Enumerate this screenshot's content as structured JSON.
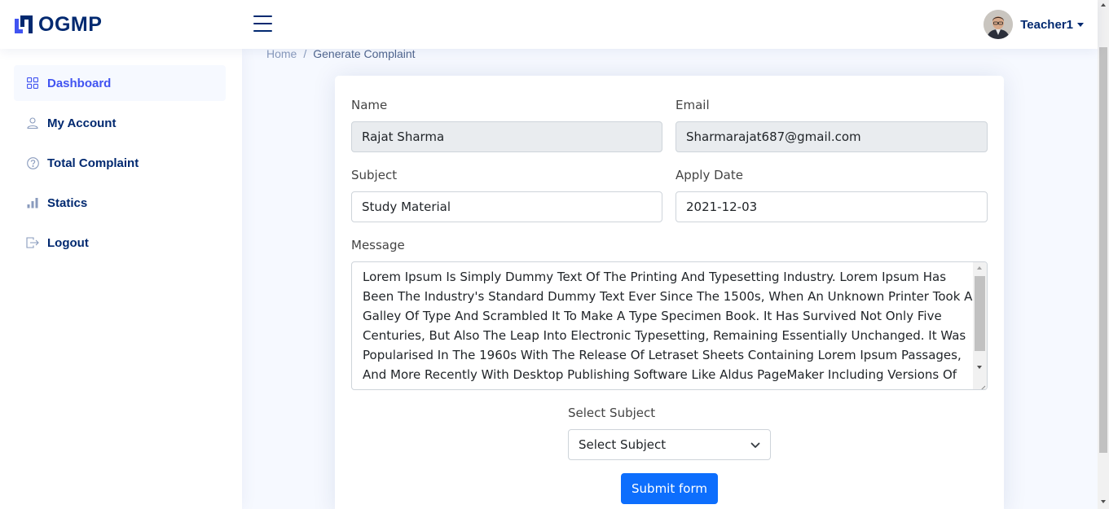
{
  "header": {
    "logo_text": "OGMP",
    "user_name": "Teacher1"
  },
  "sidebar": {
    "items": [
      {
        "label": "Dashboard",
        "icon": "grid-icon",
        "active": true
      },
      {
        "label": "My Account",
        "icon": "person-icon",
        "active": false
      },
      {
        "label": "Total Complaint",
        "icon": "question-circle-icon",
        "active": false
      },
      {
        "label": "Statics",
        "icon": "bar-chart-icon",
        "active": false
      },
      {
        "label": "Logout",
        "icon": "box-arrow-right-icon",
        "active": false
      }
    ]
  },
  "breadcrumb": {
    "home": "Home",
    "separator": "/",
    "current": "Generate Complaint"
  },
  "form": {
    "name_label": "Name",
    "name_value": "Rajat Sharma",
    "email_label": "Email",
    "email_value": "Sharmarajat687@gmail.com",
    "subject_label": "Subject",
    "subject_value": "Study Material",
    "apply_date_label": "Apply Date",
    "apply_date_value": "2021-12-03",
    "message_label": "Message",
    "message_value": "Lorem Ipsum Is Simply Dummy Text Of The Printing And Typesetting Industry. Lorem Ipsum Has Been The Industry's Standard Dummy Text Ever Since The 1500s, When An Unknown Printer Took A Galley Of Type And Scrambled It To Make A Type Specimen Book. It Has Survived Not Only Five Centuries, But Also The Leap Into Electronic Typesetting, Remaining Essentially Unchanged. It Was Popularised In The 1960s With The Release Of Letraset Sheets Containing Lorem Ipsum Passages, And More Recently With Desktop Publishing Software Like Aldus PageMaker Including Versions Of",
    "select_subject_label": "Select Subject",
    "select_subject_value": "Select Subject",
    "submit_label": "Submit form"
  },
  "colors": {
    "brand": "#012970",
    "accent": "#4154f1",
    "primary_button": "#0d6efd",
    "page_background": "#f6f9ff"
  }
}
